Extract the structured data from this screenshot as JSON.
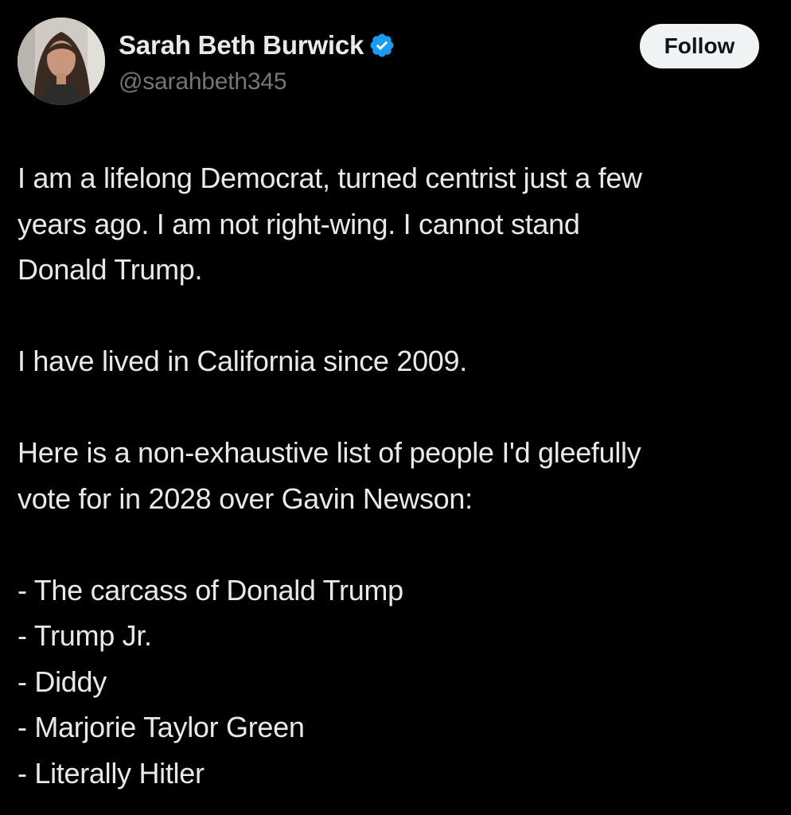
{
  "author": {
    "display_name": "Sarah Beth Burwick",
    "handle": "@sarahbeth345",
    "verified_icon": "verified-badge-icon",
    "verified_color": "#1d9bf0"
  },
  "follow_button": {
    "label": "Follow"
  },
  "post": {
    "paragraph_1_lines": [
      "I am a lifelong Democrat, turned centrist just a few",
      "years ago. I am not right-wing. I cannot stand",
      "Donald Trump."
    ],
    "paragraph_2": "I have lived in California since 2009.",
    "paragraph_3_lines": [
      "Here is a non-exhaustive list of people I'd gleefully",
      "vote for in 2028 over Gavin Newson:"
    ],
    "list": [
      "- The carcass of Donald Trump",
      "- Trump Jr.",
      "- Diddy",
      "- Marjorie Taylor Green",
      "- Literally Hitler"
    ]
  },
  "colors": {
    "background": "#000000",
    "primary_text": "#e7e9ea",
    "secondary_text": "#71767b",
    "button_bg": "#eff3f4",
    "button_text": "#0f1419"
  }
}
